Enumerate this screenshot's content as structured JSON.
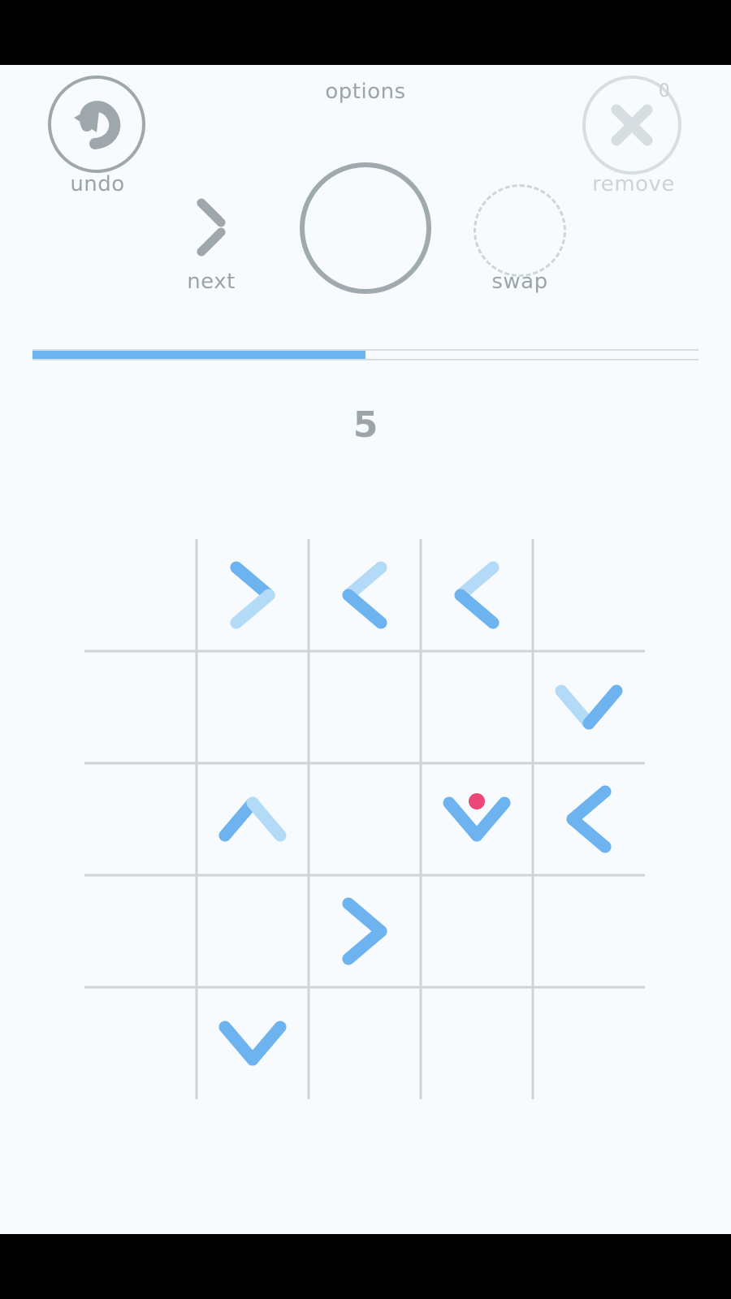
{
  "header": {
    "options_label": "options"
  },
  "controls": {
    "undo_label": "undo",
    "remove_label": "remove",
    "remove_count": "0",
    "next_label": "next",
    "swap_label": "swap"
  },
  "progress": {
    "fraction": 0.5
  },
  "score": "5",
  "icons": [
    "undo-arrow-icon",
    "remove-x-icon",
    "next-chevron-icon"
  ],
  "colors": {
    "accent": "#6cb3ef",
    "accent_light": "#b3daf7",
    "dot": "#ec4778",
    "grid": "#cdd5d8",
    "text": "#9aa4aa"
  },
  "board": {
    "rows": 5,
    "cols": 5,
    "ball": {
      "row": 2,
      "col": 3
    },
    "pieces": [
      {
        "row": 0,
        "col": 1,
        "dir": "right",
        "solid": "upper"
      },
      {
        "row": 0,
        "col": 2,
        "dir": "left",
        "solid": "lower"
      },
      {
        "row": 0,
        "col": 3,
        "dir": "left",
        "solid": "lower"
      },
      {
        "row": 1,
        "col": 4,
        "dir": "down",
        "solid": "right"
      },
      {
        "row": 2,
        "col": 1,
        "dir": "up",
        "solid": "left"
      },
      {
        "row": 2,
        "col": 3,
        "dir": "down",
        "solid": "both"
      },
      {
        "row": 2,
        "col": 4,
        "dir": "left",
        "solid": "both"
      },
      {
        "row": 3,
        "col": 2,
        "dir": "right",
        "solid": "both"
      },
      {
        "row": 4,
        "col": 1,
        "dir": "down",
        "solid": "both"
      }
    ]
  }
}
